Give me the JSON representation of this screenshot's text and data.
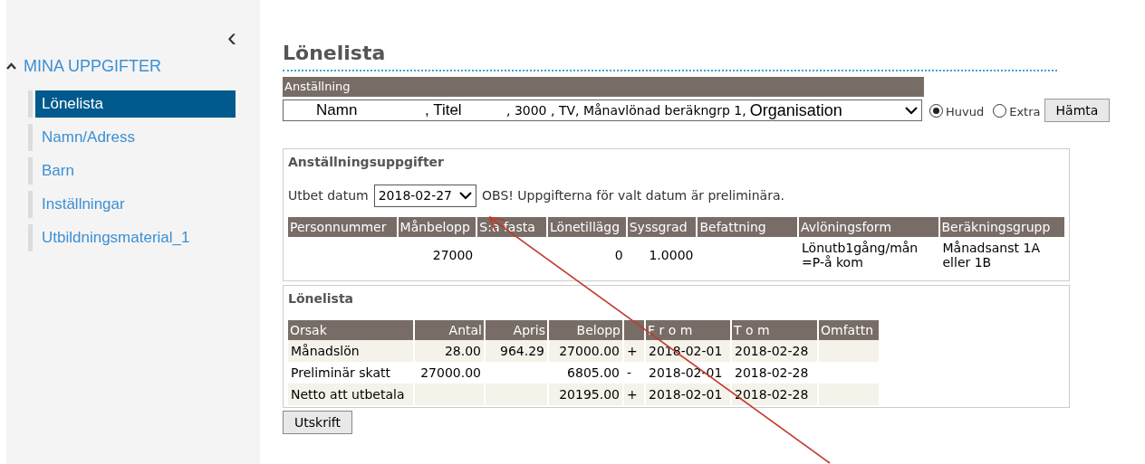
{
  "sidebar": {
    "collapse_icon": "‹",
    "section": {
      "title": "MINA UPPGIFTER",
      "expanded": true
    },
    "items": [
      {
        "label": "Lönelista",
        "selected": true
      },
      {
        "label": "Namn/Adress",
        "selected": false
      },
      {
        "label": "Barn",
        "selected": false
      },
      {
        "label": "Inställningar",
        "selected": false
      },
      {
        "label": "Utbildningsmaterial_1",
        "selected": false
      }
    ]
  },
  "page_title": "Lönelista",
  "employment": {
    "label": "Anställning",
    "select_parts": [
      "Namn",
      ", Titel",
      ", 3000 , TV, Månavlönad beräkngrp 1,",
      "Organisation"
    ],
    "radios": [
      {
        "label": "Huvud",
        "selected": true
      },
      {
        "label": "Extra",
        "selected": false
      }
    ],
    "button": "Hämta"
  },
  "details": {
    "title": "Anställningsuppgifter",
    "date_label": "Utbet datum",
    "date_value": "2018-02-27",
    "notice": "OBS! Uppgifterna för valt datum är preliminära.",
    "columns": [
      "Personnummer",
      "Månbelopp",
      "S:a fasta",
      "Lönetillägg",
      "Syssgrad",
      "Befattning",
      "Avlöningsform",
      "Beräkningsgrupp"
    ],
    "row": {
      "monthly_amount": "27000",
      "supplement": "0",
      "employment_rate": "1.0000",
      "pay_form": "Lönutb1gång/mån =P-å kom",
      "calc_group": "Månadsanst 1A eller 1B"
    }
  },
  "payslip": {
    "title": "Lönelista",
    "columns": [
      "Orsak",
      "Antal",
      "Apris",
      "Belopp",
      null,
      "F r o m",
      "T o m",
      "Omfattn"
    ],
    "rows": [
      [
        "Månadslön",
        "28.00",
        "964.29",
        "27000.00",
        "+",
        "2018-02-01",
        "2018-02-28",
        null
      ],
      [
        "Preliminär skatt",
        "27000.00",
        null,
        "6805.00",
        "-",
        "2018-02-01",
        "2018-02-28",
        null
      ],
      [
        "Netto att utbetala",
        null,
        null,
        "20195.00",
        "+",
        "2018-02-01",
        "2018-02-28",
        null
      ]
    ]
  },
  "print_button": "Utskrift"
}
